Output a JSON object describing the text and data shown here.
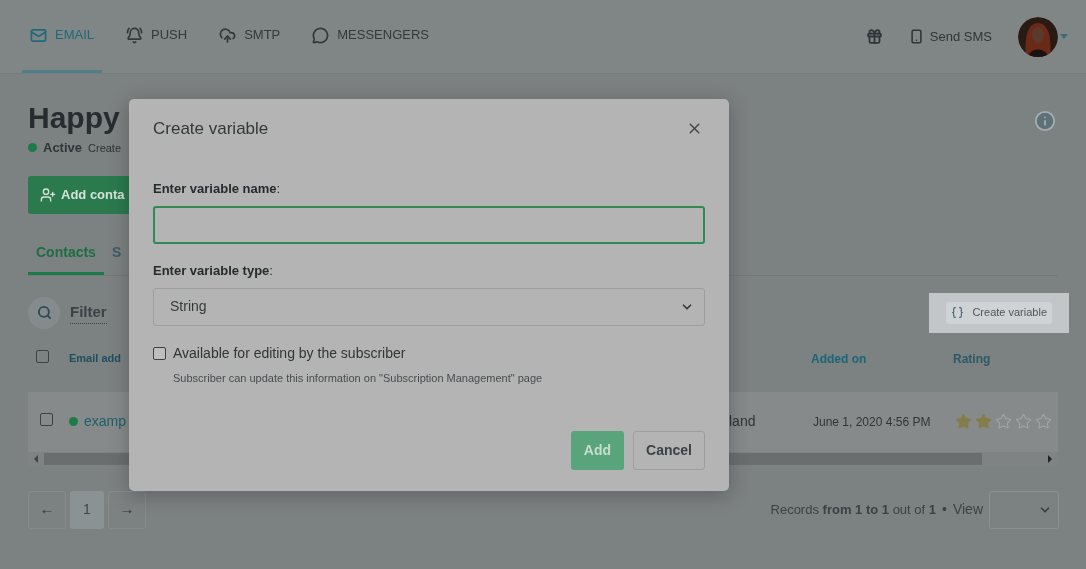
{
  "nav": {
    "tabs": [
      {
        "label": "EMAIL",
        "selected": true
      },
      {
        "label": "PUSH",
        "selected": false
      },
      {
        "label": "SMTP",
        "selected": false
      },
      {
        "label": "MESSENGERS",
        "selected": false
      }
    ],
    "send_sms": "Send SMS"
  },
  "page": {
    "title": "Happy",
    "status": "Active",
    "created": "Create",
    "add_button": "Add conta",
    "tabs": [
      {
        "label": "Contacts",
        "selected": true
      },
      {
        "label": "S",
        "selected": false
      }
    ],
    "filter": "Filter",
    "create_variable": "Create variable",
    "table": {
      "select_all": {
        "checked": false
      },
      "columns": [
        "Email add",
        "Added on",
        "Rating"
      ],
      "rows": [
        {
          "checked": false,
          "color": "#1e7a48",
          "email": "examp",
          "column_3": "land",
          "added_on": "June 1, 2020 4:56 PM",
          "stars": 2
        }
      ]
    },
    "pagination": {
      "prev": "←",
      "pages": [
        {
          "label": "1",
          "selected": true
        }
      ],
      "next": "→"
    },
    "records": "Records **from 1 to 1** out of **1**",
    "separator": "•",
    "view": "View"
  },
  "modal": {
    "title": "Create variable",
    "name_label": "**Enter variable name**:",
    "type_label": "**Enter variable type**:",
    "type_value": "String",
    "checkbox": {
      "label": "Available for editing by the subscriber",
      "checked": false
    },
    "hint": "Subscriber can update this information on \"Subscription Management\" page",
    "buttons": [
      {
        "label": "Add",
        "kind": "primary"
      },
      {
        "label": "Cancel",
        "kind": "secondary"
      }
    ]
  }
}
